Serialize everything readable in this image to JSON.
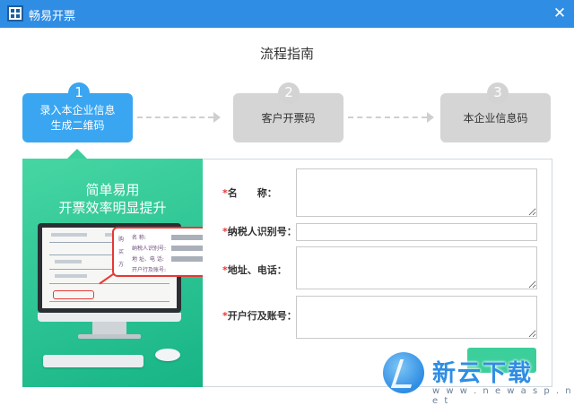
{
  "window": {
    "title": "畅易开票",
    "close_glyph": "✕",
    "logo_icon": "qr-code-icon"
  },
  "page_title": "流程指南",
  "steps": [
    {
      "number": "1",
      "label_line1": "录入本企业信息",
      "label_line2": "生成二维码",
      "active": true
    },
    {
      "number": "2",
      "label": "客户开票码",
      "active": false
    },
    {
      "number": "3",
      "label": "本企业信息码",
      "active": false
    }
  ],
  "promo": {
    "line1": "简单易用",
    "line2": "开票效率明显提升",
    "invoice_callout": {
      "side_label": "购买方",
      "rows": [
        "名 称:",
        "纳税人识别号:",
        "地 址、电 话:",
        "开户行及账号:"
      ]
    }
  },
  "form": {
    "required_mark": "*",
    "fields": [
      {
        "label": "名　　称：",
        "value": ""
      },
      {
        "label": "纳税人识别号：",
        "value": ""
      },
      {
        "label": "地址、电话：",
        "value": ""
      },
      {
        "label": "开户行及账号：",
        "value": ""
      }
    ],
    "next_button": ""
  },
  "watermark": {
    "text": "新云下载",
    "url": "w w w . n e w a s p . n e t"
  },
  "colors": {
    "titlebar": "#2f8de4",
    "step_active": "#3aa6f2",
    "step_inactive": "#d5d5d5",
    "promo_green": "#2fc593",
    "required": "#e53935"
  }
}
